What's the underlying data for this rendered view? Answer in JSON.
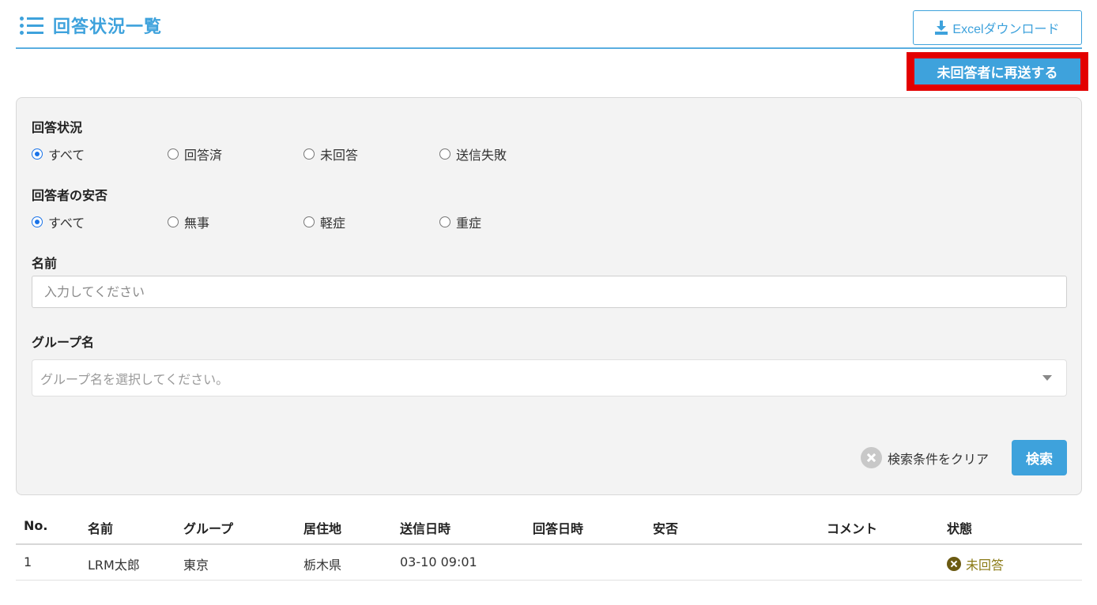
{
  "header": {
    "title": "回答状況一覧",
    "excel_button_label": "Excelダウンロード",
    "resend_button_label": "未回答者に再送する"
  },
  "filters": {
    "status_label": "回答状況",
    "status_options": [
      "すべて",
      "回答済",
      "未回答",
      "送信失敗"
    ],
    "status_selected": "すべて",
    "safety_label": "回答者の安否",
    "safety_options": [
      "すべて",
      "無事",
      "軽症",
      "重症"
    ],
    "safety_selected": "すべて",
    "name_label": "名前",
    "name_placeholder": "入力してください",
    "name_value": "",
    "group_label": "グループ名",
    "group_placeholder": "グループ名を選択してください。",
    "clear_label": "検索条件をクリア",
    "search_label": "検索"
  },
  "table": {
    "columns": [
      "No.",
      "名前",
      "グループ",
      "居住地",
      "送信日時",
      "回答日時",
      "安否",
      "コメント",
      "状態"
    ],
    "rows": [
      {
        "no": "1",
        "name": "LRM太郎",
        "group": "東京",
        "residence": "栃木県",
        "sent_at": "03-10 09:01",
        "answered_at": "",
        "safety": "",
        "comment": "",
        "status": "未回答"
      }
    ]
  },
  "colors": {
    "accent": "#3ea2dc",
    "highlight_frame": "#e30000",
    "status_unanswered": "#8a7a14"
  },
  "icons": {
    "title": "list-icon",
    "excel": "download-icon",
    "clear": "clear-circle-icon",
    "status": "x-circle-icon"
  }
}
